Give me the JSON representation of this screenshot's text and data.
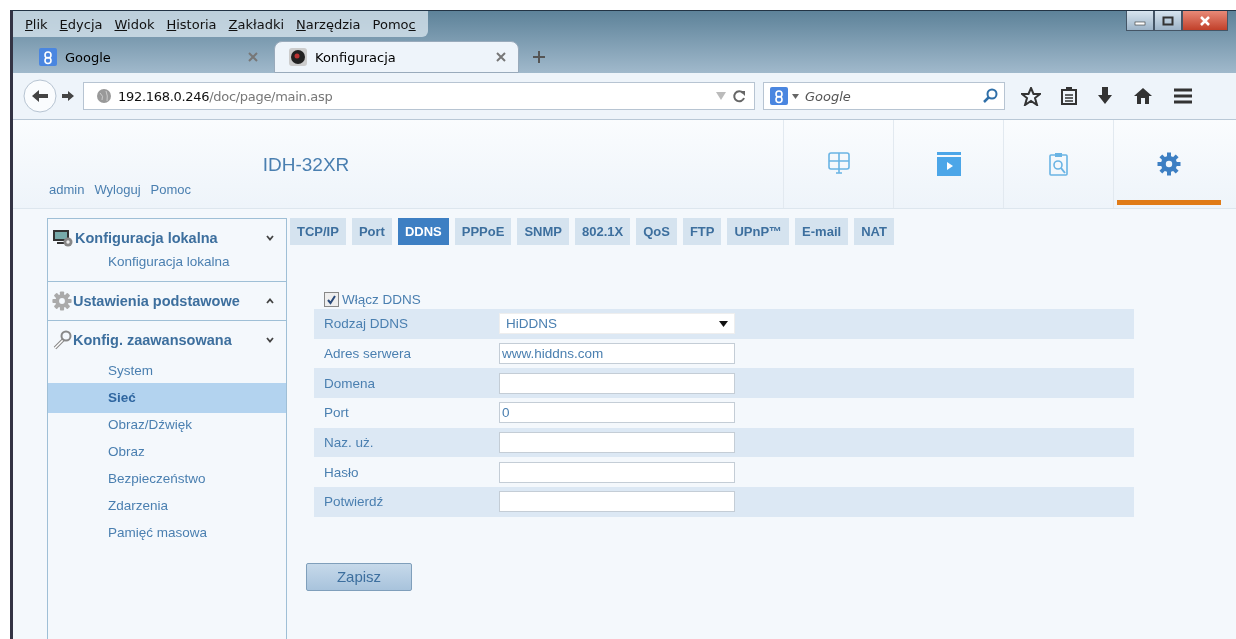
{
  "menu": [
    {
      "key": "P",
      "after": "lik"
    },
    {
      "key": "E",
      "after": "dycja"
    },
    {
      "key": "W",
      "after": "idok"
    },
    {
      "key": "H",
      "after": "istoria"
    },
    {
      "key": "Z",
      "after": "akładki"
    },
    {
      "key": "N",
      "after": "arzędzia"
    },
    {
      "before": "Pomo",
      "key": "c"
    }
  ],
  "browser_tabs": [
    {
      "title": "Google",
      "kind": "google",
      "selected": false
    },
    {
      "title": "Konfiguracja",
      "kind": "camera",
      "selected": true
    }
  ],
  "address": {
    "host": "192.168.0.246",
    "path": "/doc/page/main.asp"
  },
  "search": {
    "placeholder": "Google"
  },
  "header": {
    "title": "IDH-32XR",
    "links": [
      "admin",
      "Wyloguj",
      "Pomoc"
    ]
  },
  "nav": [
    {
      "kind": "live",
      "selected": false
    },
    {
      "kind": "playback",
      "selected": false
    },
    {
      "kind": "search",
      "selected": false
    },
    {
      "kind": "settings",
      "selected": true
    }
  ],
  "sidebar": [
    {
      "title": "Konfiguracja lokalna",
      "kind": "local",
      "expanded": true,
      "children": [
        {
          "label": "Konfiguracja lokalna",
          "selected": false
        }
      ]
    },
    {
      "title": "Ustawienia podstawowe",
      "kind": "basic",
      "expanded": false
    },
    {
      "title": "Konfig. zaawansowana",
      "kind": "advanced",
      "expanded": true,
      "children": [
        {
          "label": "System",
          "selected": false
        },
        {
          "label": "Sieć",
          "selected": true
        },
        {
          "label": "Obraz/Dźwięk",
          "selected": false
        },
        {
          "label": "Obraz",
          "selected": false
        },
        {
          "label": "Bezpieczeństwo",
          "selected": false
        },
        {
          "label": "Zdarzenia",
          "selected": false
        },
        {
          "label": "Pamięć masowa",
          "selected": false
        }
      ]
    }
  ],
  "tabs": [
    {
      "label": "TCP/IP",
      "selected": false
    },
    {
      "label": "Port",
      "selected": false
    },
    {
      "label": "DDNS",
      "selected": true
    },
    {
      "label": "PPPoE",
      "selected": false
    },
    {
      "label": "SNMP",
      "selected": false
    },
    {
      "label": "802.1X",
      "selected": false
    },
    {
      "label": "QoS",
      "selected": false
    },
    {
      "label": "FTP",
      "selected": false
    },
    {
      "label": "UPnP™",
      "selected": false
    },
    {
      "label": "E-mail",
      "selected": false
    },
    {
      "label": "NAT",
      "selected": false
    }
  ],
  "enable": {
    "label": "Włącz DDNS",
    "checked": true
  },
  "fields": [
    {
      "label": "Rodzaj DDNS",
      "kind": "select",
      "value": "HiDDNS"
    },
    {
      "label": "Adres serwera",
      "kind": "text",
      "value": "www.hiddns.com"
    },
    {
      "label": "Domena",
      "kind": "text"
    },
    {
      "label": "Port",
      "kind": "text",
      "value": "0"
    },
    {
      "label": "Naz. uż.",
      "kind": "text"
    },
    {
      "label": "Hasło",
      "kind": "text"
    },
    {
      "label": "Potwierdź",
      "kind": "text"
    }
  ],
  "save_button": "Zapisz"
}
